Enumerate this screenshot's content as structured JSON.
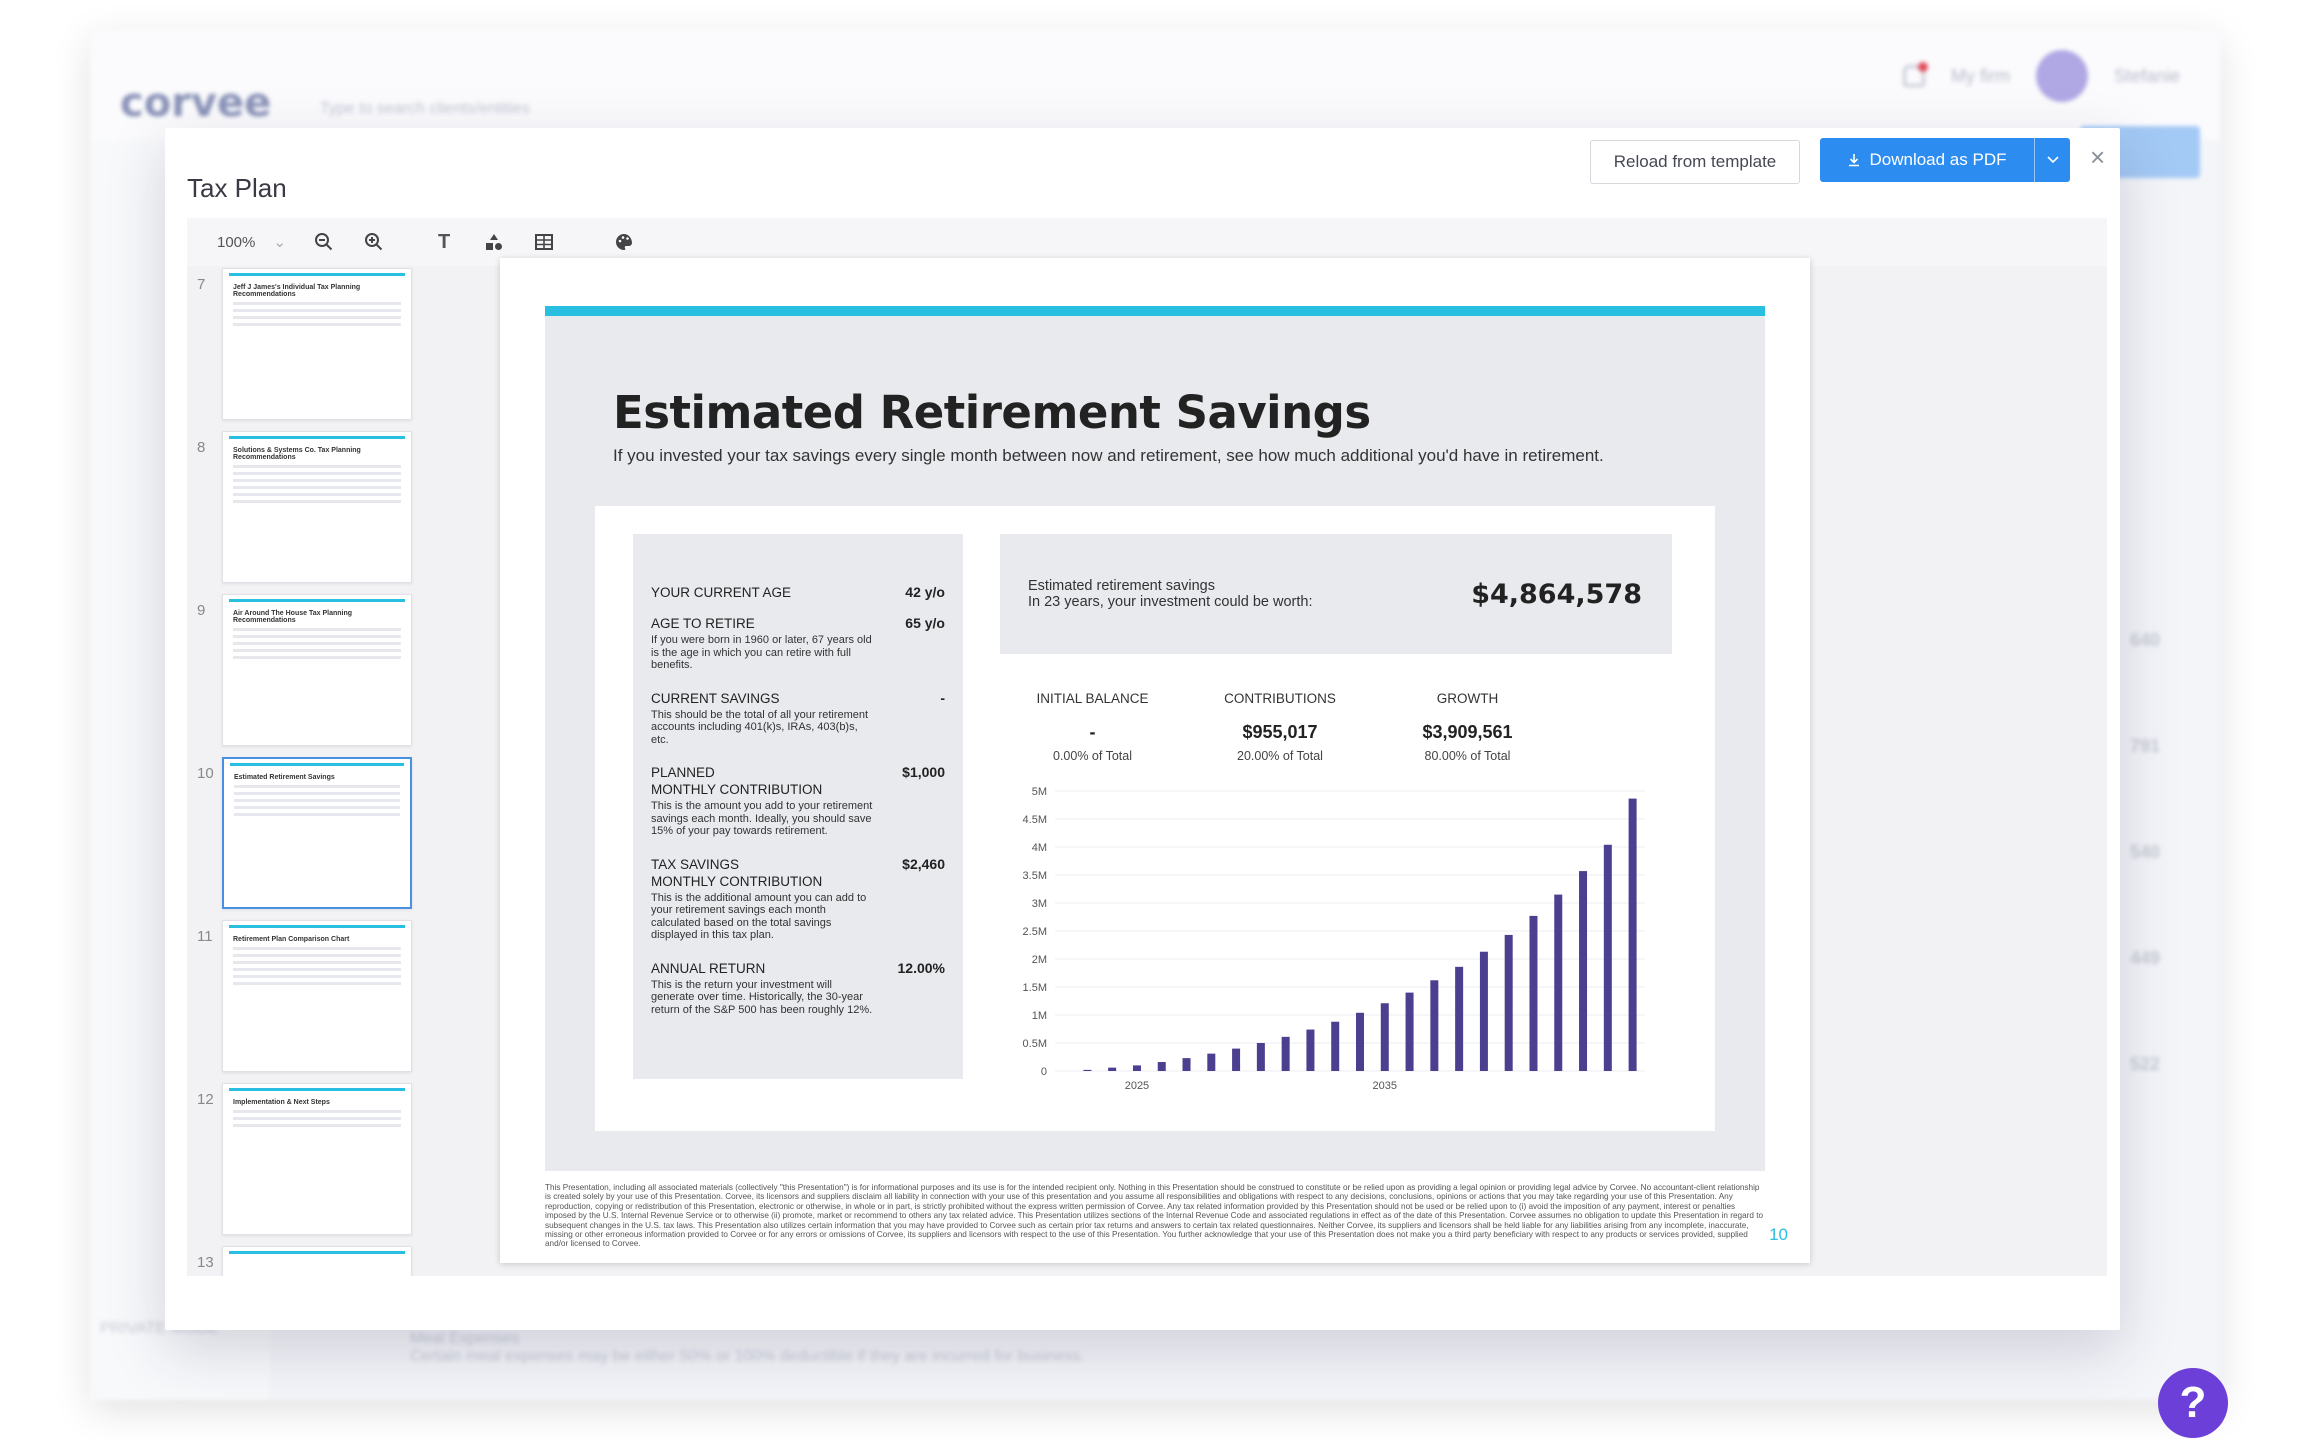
{
  "background": {
    "logo": "corvee",
    "search_placeholder": "Type to search clients/entities",
    "firm": "My firm",
    "user": "Stefanie",
    "nums": [
      "640",
      "791",
      "540",
      "449",
      "522"
    ],
    "footer_mode": "PRIVATE MODE",
    "footer_row": "Meal Expenses",
    "footer_row_desc": "Certain meal expenses may be either 50% or 100% deductible if they are incurred for business."
  },
  "modal": {
    "title": "Tax Plan",
    "reload_label": "Reload from template",
    "download_label": "Download as PDF",
    "close": "×"
  },
  "toolbar": {
    "zoom": "100%"
  },
  "thumbnails": [
    {
      "num": "7",
      "title": "Jeff J James's Individual Tax Planning Recommendations"
    },
    {
      "num": "8",
      "title": "Solutions & Systems Co. Tax Planning Recommendations"
    },
    {
      "num": "9",
      "title": "Air Around The House Tax Planning Recommendations"
    },
    {
      "num": "10",
      "title": "Estimated Retirement Savings"
    },
    {
      "num": "11",
      "title": "Retirement Plan Comparison Chart"
    },
    {
      "num": "12",
      "title": "Implementation & Next Steps"
    },
    {
      "num": "13",
      "title": ""
    }
  ],
  "slide": {
    "title": "Estimated Retirement Savings",
    "subtitle": "If you invested your tax savings every single month between now and retirement, see how much additional you'd have in retirement.",
    "current_age_label": "YOUR CURRENT AGE",
    "current_age": "42 y/o",
    "retire_age_label": "AGE TO RETIRE",
    "retire_age": "65 y/o",
    "retire_age_note": "If you were born in 1960 or later, 67 years old is the age in which you can retire with full benefits.",
    "current_savings_label": "CURRENT SAVINGS",
    "current_savings": "-",
    "current_savings_note": "This should be the total of all your retirement accounts including 401(k)s, IRAs, 403(b)s, etc.",
    "planned_label_1": "PLANNED",
    "planned_label_2": "MONTHLY CONTRIBUTION",
    "planned": "$1,000",
    "planned_note": "This is the amount you add to your retirement savings each month. Ideally, you should save 15% of your pay towards retirement.",
    "tax_label_1": "TAX SAVINGS",
    "tax_label_2": "MONTHLY CONTRIBUTION",
    "tax": "$2,460",
    "tax_note": "This is the additional amount you can add to your retirement savings each month calculated based on the total savings displayed in this tax plan.",
    "return_label": "ANNUAL RETURN",
    "return": "12.00%",
    "return_note": "This is the return your investment will generate over time. Historically, the 30-year return of the S&P 500 has been roughly 12%.",
    "est_label_1": "Estimated retirement savings",
    "est_label_2": "In 23 years, your investment could be worth:",
    "est_amount": "$4,864,578",
    "stats": [
      {
        "head": "INITIAL BALANCE",
        "value": "-",
        "pct": "0.00% of Total"
      },
      {
        "head": "CONTRIBUTIONS",
        "value": "$955,017",
        "pct": "20.00% of Total"
      },
      {
        "head": "GROWTH",
        "value": "$3,909,561",
        "pct": "80.00% of Total"
      }
    ],
    "disclaimer": "This Presentation, including all associated materials (collectively \"this Presentation\") is for informational purposes and its use is for the intended recipient only. Nothing in this Presentation should be construed to constitute or be relied upon as providing a legal opinion or providing legal advice by Corvee. No accountant-client relationship is created solely by your use of this Presentation. Corvee, its licensors and suppliers disclaim all liability in connection with your use of this presentation and you assume all responsibilities and obligations with respect to any decisions, conclusions, opinions or actions that you may take regarding your use of this Presentation. Any reproduction, copying or redistribution of this Presentation, electronic or otherwise, in whole or in part, is strictly prohibited without the express written permission of Corvee. Any tax related information provided by this Presentation should not be used or be relied upon to (i) avoid the imposition of any payment, interest or penalties imposed by the U.S. Internal Revenue Service or to otherwise (ii) promote, market or recommend to others any tax related advice. This Presentation utilizes sections of the Internal Revenue Code and associated regulations in effect as of the date of this Presentation. Corvee assumes no obligation to update this Presentation in regard to subsequent changes in the U.S. tax laws. This Presentation also utilizes certain information that you may have provided to Corvee such as certain prior tax returns and answers to certain tax related questionnaires. Neither Corvee, its suppliers and licensors shall be held liable for any liabilities arising from any incomplete, inaccurate, missing or other erroneous information provided to Corvee or for any errors or omissions of Corvee, its suppliers and licensors with respect to the use of this Presentation. You further acknowledge that your use of this Presentation does not make you a third party beneficiary with respect to any products or services provided, supplied and/or licensed to Corvee.",
    "page_num": "10"
  },
  "chart_data": {
    "type": "bar",
    "x": [
      2023,
      2024,
      2025,
      2026,
      2027,
      2028,
      2029,
      2030,
      2031,
      2032,
      2033,
      2034,
      2035,
      2036,
      2037,
      2038,
      2039,
      2040,
      2041,
      2042,
      2043,
      2044,
      2045
    ],
    "x_ticks": [
      "2025",
      "2035"
    ],
    "values": [
      20000,
      60000,
      100000,
      160000,
      230000,
      310000,
      400000,
      500000,
      610000,
      740000,
      880000,
      1040000,
      1210000,
      1400000,
      1620000,
      1860000,
      2130000,
      2430000,
      2770000,
      3150000,
      3570000,
      4040000,
      4864578
    ],
    "y_ticks": [
      "0",
      "0.5M",
      "1M",
      "1.5M",
      "2M",
      "2.5M",
      "3M",
      "3.5M",
      "4M",
      "4.5M",
      "5M"
    ],
    "ylim": [
      0,
      5000000
    ],
    "color": "#4b3f8f",
    "grid": true
  }
}
